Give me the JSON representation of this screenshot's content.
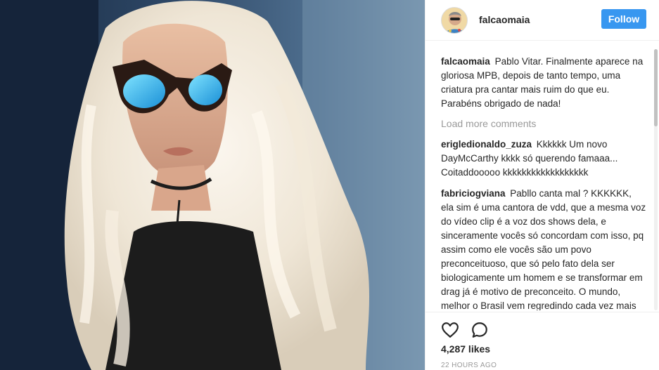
{
  "header": {
    "username": "falcaomaia",
    "follow_label": "Follow"
  },
  "colors": {
    "accent": "#3897f0",
    "muted_text": "#999999",
    "text": "#262626"
  },
  "caption": {
    "user": "falcaomaia",
    "text": "Pablo Vitar. Finalmente aparece na gloriosa MPB, depois de tanto tempo, uma criatura pra cantar mais ruim do que eu. Parabéns obrigado de nada!"
  },
  "load_more_label": "Load more comments",
  "comments": [
    {
      "user": "erigledionaldo_zuza",
      "text": "Kkkkkk Um novo DayMcCarthy kkkk só querendo famaaa... Coitaddooooo kkkkkkkkkkkkkkkkkk"
    },
    {
      "user": "fabriciogviana",
      "text": "Pabllo canta mal ? KKKKKK, ela sim é uma cantora de vdd, que a mesma voz do vídeo clip é a voz dos shows dela, e sinceramente vocês só concordam com isso, pq assim como ele vocês são um povo preconceituoso, que só pelo fato dela ser biologicamente um homem e se transformar em drag já é motivo de preconceito. O mundo, melhor o Brasil vem regredindo cada vez mais do que evoluindo, e depois vem um monte de"
    }
  ],
  "actions": {
    "like_icon": "heart-outline-icon",
    "comment_icon": "comment-bubble-icon"
  },
  "likes": "4,287 likes",
  "timestamp": "22 HOURS AGO"
}
